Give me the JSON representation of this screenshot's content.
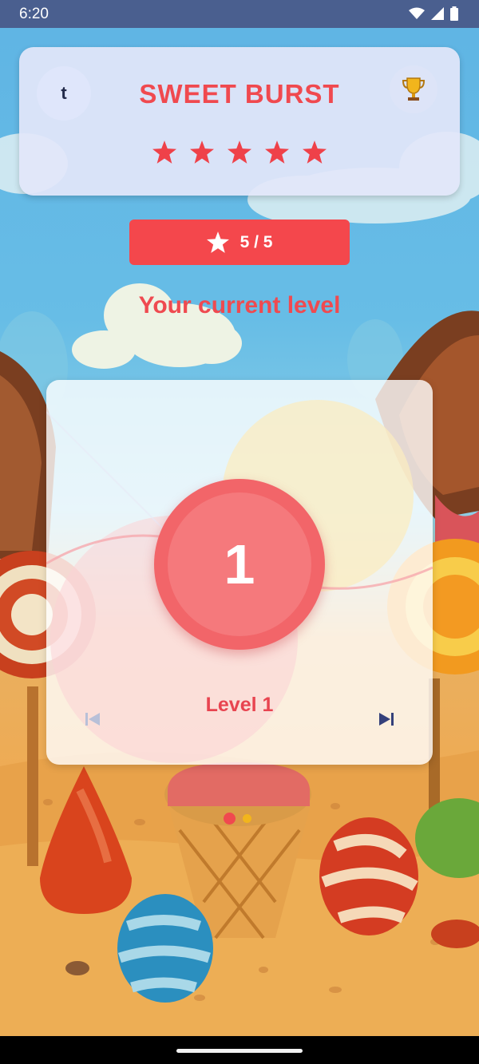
{
  "status_bar": {
    "time": "6:20"
  },
  "header": {
    "avatar_letter": "t",
    "title": "SWEET BURST",
    "trophy_icon": "trophy-icon",
    "rating": 5,
    "rating_max": 5
  },
  "score": {
    "icon": "star-icon",
    "text": "5 / 5"
  },
  "current_level_label": "Your current level",
  "level_card": {
    "number": "1",
    "name": "Level 1",
    "prev_icon": "skip-previous-icon",
    "next_icon": "skip-next-icon"
  },
  "pager": {
    "count": 2,
    "active": 0
  },
  "colors": {
    "accent": "#f0494f",
    "status_bar": "#4a5f8f",
    "pill": "#f4474c"
  }
}
